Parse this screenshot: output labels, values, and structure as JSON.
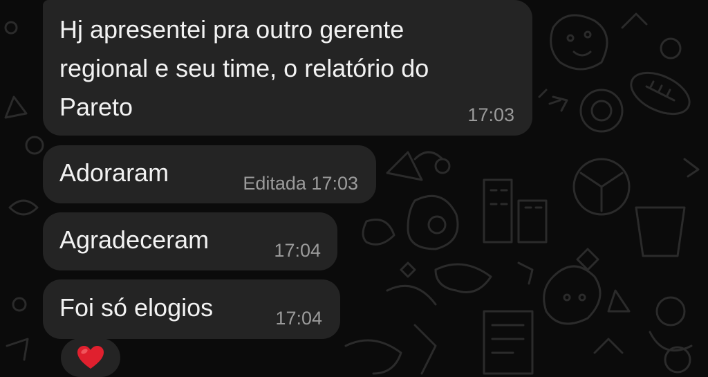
{
  "messages": [
    {
      "text": "Hj apresentei pra outro gerente\nregional e seu time, o relatório do\nPareto",
      "edited": "",
      "time": "17:03"
    },
    {
      "text": "Adoraram",
      "edited": "Editada",
      "time": "17:03"
    },
    {
      "text": "Agradeceram",
      "edited": "",
      "time": "17:04"
    },
    {
      "text": "Foi só elogios",
      "edited": "",
      "time": "17:04"
    }
  ],
  "reaction": {
    "icon": "heart-icon",
    "color": "#e0202e"
  },
  "colors": {
    "background": "#0b0b0b",
    "bubble": "#242424",
    "text": "#f2f2f2",
    "meta": "#9b9b9b",
    "doodle": "#2b2b2b"
  }
}
